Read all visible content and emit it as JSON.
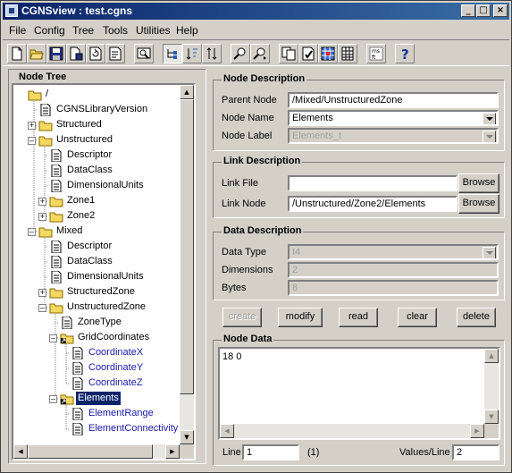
{
  "window": {
    "title": "CGNSview : test.cgns"
  },
  "menu": [
    "File",
    "Config",
    "Tree",
    "Tools",
    "Utilities",
    "Help"
  ],
  "toolbar_icons": [
    "new-file-icon",
    "open-folder-icon",
    "save-icon",
    "save-as-icon",
    "reload-icon",
    "properties-icon",
    "preview-icon",
    "tree-expand-icon",
    "tree-sort-icon",
    "sort-arrows-icon",
    "find-icon",
    "find-next-icon",
    "copy-icon",
    "check-icon",
    "grid-icon",
    "table-icon",
    "units-icon",
    "help-icon"
  ],
  "node_tree": {
    "title": "Node Tree",
    "rows": [
      {
        "label": "/",
        "indent": 0,
        "icon": "folder",
        "expander": "",
        "style": "normal"
      },
      {
        "label": "CGNSLibraryVersion",
        "indent": 1,
        "icon": "doc",
        "expander": "",
        "style": "normal"
      },
      {
        "label": "Structured",
        "indent": 1,
        "icon": "folder",
        "expander": "+",
        "style": "normal"
      },
      {
        "label": "Unstructured",
        "indent": 1,
        "icon": "folder",
        "expander": "-",
        "style": "normal"
      },
      {
        "label": "Descriptor",
        "indent": 2,
        "icon": "doc",
        "expander": "",
        "style": "normal"
      },
      {
        "label": "DataClass",
        "indent": 2,
        "icon": "doc",
        "expander": "",
        "style": "normal"
      },
      {
        "label": "DimensionalUnits",
        "indent": 2,
        "icon": "doc",
        "expander": "",
        "style": "normal"
      },
      {
        "label": "Zone1",
        "indent": 2,
        "icon": "folder",
        "expander": "+",
        "style": "normal"
      },
      {
        "label": "Zone2",
        "indent": 2,
        "icon": "folder",
        "expander": "+",
        "style": "normal"
      },
      {
        "label": "Mixed",
        "indent": 1,
        "icon": "folder",
        "expander": "-",
        "style": "normal"
      },
      {
        "label": "Descriptor",
        "indent": 2,
        "icon": "doc",
        "expander": "",
        "style": "normal"
      },
      {
        "label": "DataClass",
        "indent": 2,
        "icon": "doc",
        "expander": "",
        "style": "normal"
      },
      {
        "label": "DimensionalUnits",
        "indent": 2,
        "icon": "doc",
        "expander": "",
        "style": "normal"
      },
      {
        "label": "StructuredZone",
        "indent": 2,
        "icon": "folder",
        "expander": "+",
        "style": "normal"
      },
      {
        "label": "UnstructuredZone",
        "indent": 2,
        "icon": "folder",
        "expander": "-",
        "style": "normal"
      },
      {
        "label": "ZoneType",
        "indent": 3,
        "icon": "doc",
        "expander": "",
        "style": "normal"
      },
      {
        "label": "GridCoordinates",
        "indent": 3,
        "icon": "linkfolder",
        "expander": "-",
        "style": "normal"
      },
      {
        "label": "CoordinateX",
        "indent": 4,
        "icon": "doc",
        "expander": "",
        "style": "link"
      },
      {
        "label": "CoordinateY",
        "indent": 4,
        "icon": "doc",
        "expander": "",
        "style": "link"
      },
      {
        "label": "CoordinateZ",
        "indent": 4,
        "icon": "doc",
        "expander": "",
        "style": "link"
      },
      {
        "label": "Elements",
        "indent": 3,
        "icon": "linkfolder",
        "expander": "-",
        "style": "selected"
      },
      {
        "label": "ElementRange",
        "indent": 4,
        "icon": "doc",
        "expander": "",
        "style": "link"
      },
      {
        "label": "ElementConnectivity",
        "indent": 4,
        "icon": "doc",
        "expander": "",
        "style": "link"
      }
    ]
  },
  "node_description": {
    "title": "Node Description",
    "parent_label": "Parent Node",
    "parent_value": "/Mixed/UnstructuredZone",
    "name_label": "Node Name",
    "name_value": "Elements",
    "node_label_label": "Node Label",
    "node_label_value": "Elements_t"
  },
  "link_description": {
    "title": "Link Description",
    "file_label": "Link File",
    "file_value": "",
    "node_label": "Link Node",
    "node_value": "/Unstructured/Zone2/Elements",
    "browse_label": "Browse"
  },
  "data_description": {
    "title": "Data Description",
    "type_label": "Data Type",
    "type_value": "I4",
    "dims_label": "Dimensions",
    "dims_value": "2",
    "bytes_label": "Bytes",
    "bytes_value": "8"
  },
  "actions": {
    "create": "create",
    "modify": "modify",
    "read": "read",
    "clear": "clear",
    "delete": "delete"
  },
  "node_data": {
    "title": "Node Data",
    "content": "18 0",
    "line_label": "Line",
    "line_value": "1",
    "line_count": "(1)",
    "values_label": "Values/Line",
    "values_value": "2"
  },
  "colors": {
    "title_bar_start": "#0a246a",
    "title_bar_end": "#3a6ea5",
    "selection": "#0a246a",
    "link_text": "#1a1aa8",
    "face": "#d4d0c8"
  }
}
